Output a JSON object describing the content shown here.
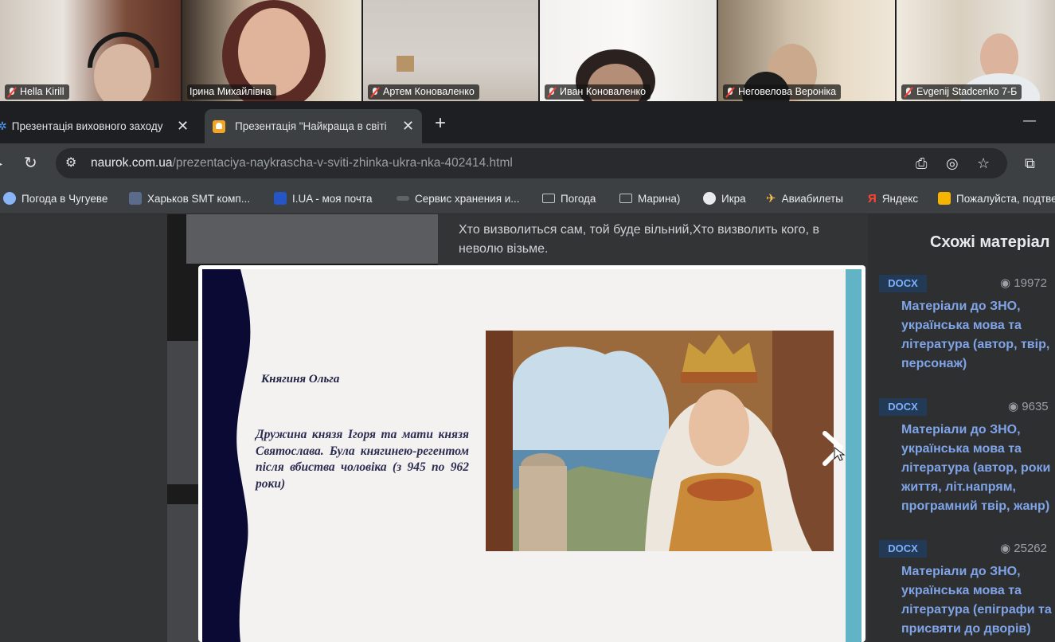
{
  "participants": [
    {
      "name": "Hella Kirill",
      "muted": true
    },
    {
      "name": "Ірина Михайлівна",
      "muted": false,
      "active_speaker": true
    },
    {
      "name": "Артем Коноваленко",
      "muted": true
    },
    {
      "name": "Иван Коноваленко",
      "muted": true
    },
    {
      "name": "Неговелова Вероніка",
      "muted": true
    },
    {
      "name": "Evgenij Stadcenko 7-Б",
      "muted": true
    }
  ],
  "tabs": [
    {
      "title": "Презентація виховного заходу",
      "active": false
    },
    {
      "title": "Презентація \"Найкраща в світі",
      "active": true
    }
  ],
  "new_tab_label": "+",
  "window_minimize": "—",
  "address": {
    "host": "naurok.com.ua",
    "path": "/prezentaciya-naykrascha-v-sviti-zhinka-ukra-nka-402414.html"
  },
  "bookmarks": [
    {
      "label": "Погода в Чугуеве",
      "icon": "weather-icon"
    },
    {
      "label": "Харьков SMT комп...",
      "icon": "smt-icon"
    },
    {
      "label": "I.UA - моя почта",
      "icon": "iua-icon"
    },
    {
      "label": "Сервис хранения и...",
      "icon": "storage-icon"
    },
    {
      "label": "Погода",
      "icon": "folder-icon"
    },
    {
      "label": "Марина)",
      "icon": "folder-icon"
    },
    {
      "label": "Икра",
      "icon": "globe-icon"
    },
    {
      "label": "Авиабилеты",
      "icon": "plane-icon"
    },
    {
      "label": "Яндекс",
      "icon": "yandex-icon"
    },
    {
      "label": "Пожалуйста, подтве",
      "icon": "smile-icon"
    }
  ],
  "article": {
    "text": "Хто визволиться сам, той буде вільний,Хто визволить кого, в неволю візьме."
  },
  "sidebar": {
    "title": "Схожі матеріал",
    "cards": [
      {
        "badge": "DOCX",
        "views": "19972",
        "title": "Матеріали до ЗНО, українська мова та література (автор, твір, персонаж)"
      },
      {
        "badge": "DOCX",
        "views": "9635",
        "title": "Матеріали до ЗНО, українська мова та література (автор, роки життя, літ.напрям, програмний твір, жанр)"
      },
      {
        "badge": "DOCX",
        "views": "25262",
        "title": "Матеріали до ЗНО, українська мова та література (епіграфи та присвяти до дворів)"
      }
    ]
  },
  "slide": {
    "heading": "Княгиня Ольга",
    "body": "Дружина князя Ігоря та мати князя Святослава. Була княгинею-регентом після вбиства чоловіка (з 945 по 962 роки)"
  },
  "colors": {
    "active_tile_border": "#3ddc84",
    "mute_red": "#ff3b30",
    "slide_teal": "#63b3c7",
    "slide_navy": "#0b0a35",
    "link_blue": "#7fa4e8"
  }
}
